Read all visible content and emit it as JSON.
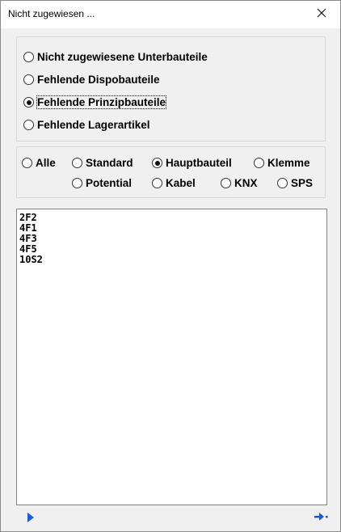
{
  "window": {
    "title": "Nicht zugewiesen ..."
  },
  "mode": {
    "options": [
      {
        "label": "Nicht zugewiesene Unterbauteile",
        "checked": false
      },
      {
        "label": "Fehlende Dispobauteile",
        "checked": false
      },
      {
        "label": "Fehlende Prinzipbauteile",
        "checked": true
      },
      {
        "label": "Fehlende Lagerartikel",
        "checked": false
      }
    ]
  },
  "filter": {
    "row1": [
      {
        "label": "Alle",
        "checked": false
      },
      {
        "label": "Standard",
        "checked": false
      },
      {
        "label": "Hauptbauteil",
        "checked": true
      },
      {
        "label": "Klemme",
        "checked": false
      }
    ],
    "row2": [
      {
        "label": "Potential",
        "checked": false
      },
      {
        "label": "Kabel",
        "checked": false
      },
      {
        "label": "KNX",
        "checked": false
      },
      {
        "label": "SPS",
        "checked": false
      }
    ]
  },
  "list": {
    "items": [
      "2F2",
      "4F1",
      "4F3",
      "4F5",
      "10S2"
    ]
  },
  "icons": {
    "play": "play-icon",
    "go": "arrow-right-dots-icon",
    "close": "close-icon",
    "accent": "#1a5bd6"
  }
}
